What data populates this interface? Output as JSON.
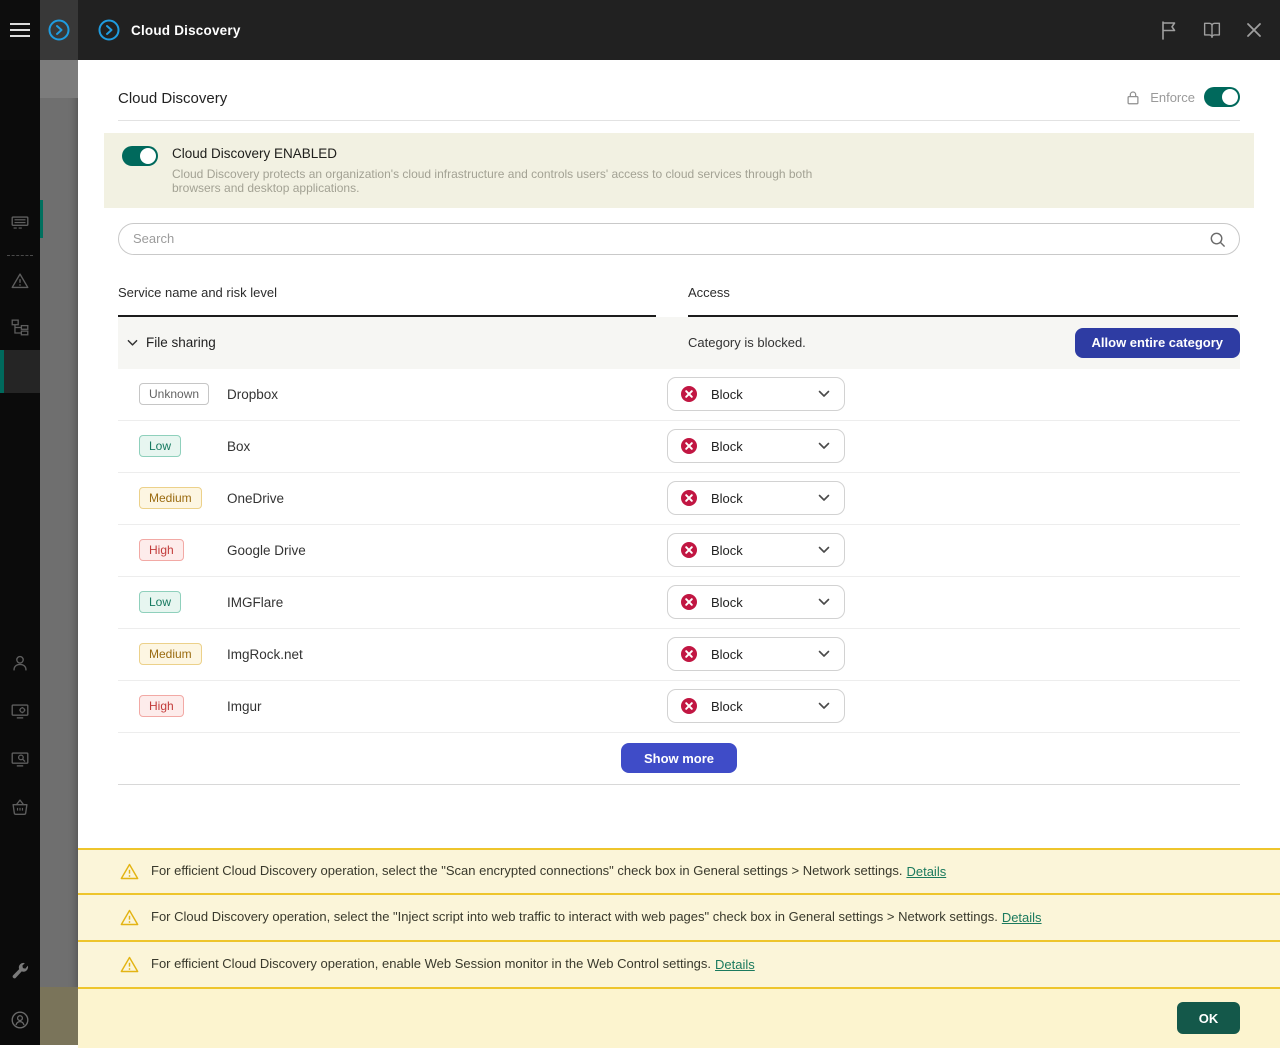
{
  "header": {
    "title": "Cloud Discovery",
    "icons": {
      "hamburger": "menu (three lines)",
      "app_chevron": "blue circled chevron-right",
      "flag": "flag outline",
      "help_book": "open book outline",
      "close": "x cross"
    }
  },
  "sidebar": {
    "items": [
      {
        "name": "devices",
        "icon": "device-list-icon"
      },
      {
        "name": "alerts",
        "icon": "alert-triangle-icon"
      },
      {
        "name": "hierarchy",
        "icon": "tree-icon"
      },
      {
        "name": "selected-section",
        "icon": "none (highlighted row)"
      },
      {
        "name": "users",
        "icon": "person-icon"
      },
      {
        "name": "device-settings",
        "icon": "monitor-gear-icon"
      },
      {
        "name": "monitoring",
        "icon": "monitor-search-icon"
      },
      {
        "name": "marketplace",
        "icon": "basket-icon"
      },
      {
        "name": "tools",
        "icon": "wrench-icon"
      },
      {
        "name": "account",
        "icon": "person-circle-icon"
      }
    ]
  },
  "page": {
    "title": "Cloud Discovery",
    "enforce": {
      "label": "Enforce",
      "enabled": true,
      "icon": "lock-icon"
    },
    "banner": {
      "title": "Cloud Discovery ENABLED",
      "description": "Cloud Discovery protects an organization's cloud infrastructure and controls users' access to cloud services through both browsers and desktop applications.",
      "toggle_on": true
    },
    "search": {
      "placeholder": "Search",
      "value": "",
      "icon": "search-icon"
    },
    "table": {
      "columns": [
        "Service name and risk level",
        "Access"
      ],
      "category": {
        "name": "File sharing",
        "status": "Category is blocked.",
        "action_label": "Allow entire category",
        "expanded": true
      },
      "rows": [
        {
          "risk": "Unknown",
          "risk_level": "unknown",
          "service": "Dropbox",
          "access": "Block"
        },
        {
          "risk": "Low",
          "risk_level": "low",
          "service": "Box",
          "access": "Block"
        },
        {
          "risk": "Medium",
          "risk_level": "medium",
          "service": "OneDrive",
          "access": "Block"
        },
        {
          "risk": "High",
          "risk_level": "high",
          "service": "Google Drive",
          "access": "Block"
        },
        {
          "risk": "Low",
          "risk_level": "low",
          "service": "IMGFlare",
          "access": "Block"
        },
        {
          "risk": "Medium",
          "risk_level": "medium",
          "service": "ImgRock.net",
          "access": "Block"
        },
        {
          "risk": "High",
          "risk_level": "high",
          "service": "Imgur",
          "access": "Block"
        }
      ],
      "show_more_label": "Show more"
    },
    "warnings": [
      {
        "icon": "warning-triangle-icon",
        "text": "For efficient Cloud Discovery operation, select the \"Scan encrypted connections\" check box in General settings > Network settings.",
        "link": "Details"
      },
      {
        "icon": "warning-triangle-icon",
        "text": "For Cloud Discovery operation, select the \"Inject script into web traffic to interact with web pages\" check box in General settings > Network settings.",
        "link": "Details"
      },
      {
        "icon": "warning-triangle-icon",
        "text": "For efficient Cloud Discovery operation, enable Web Session monitor in the Web Control settings.",
        "link": "Details"
      }
    ],
    "footer": {
      "ok_label": "OK"
    }
  },
  "colors": {
    "accent_teal": "#00695c",
    "ok_button": "#14584a",
    "allow_button": "#2e3ca3",
    "show_more_button": "#3f4cc8",
    "block_red": "#c11642",
    "warning_bg": "#fbf5d9",
    "warning_line": "#eec52c",
    "banner_bg": "#f2f1e2",
    "topbar_bg": "#212121",
    "sidebar_bg": "#0b0b0b",
    "app_blue": "#1f9ce0"
  }
}
